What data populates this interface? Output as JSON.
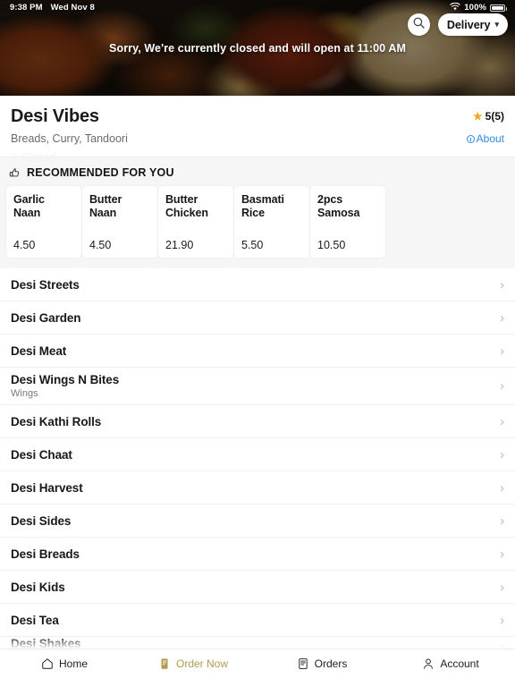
{
  "status_bar": {
    "time": "9:38 PM",
    "date": "Wed Nov 8",
    "battery_percent": "100%",
    "wifi_icon": "wifi-icon",
    "battery_icon": "battery-icon"
  },
  "hero": {
    "search_icon": "search-icon",
    "order_mode_label": "Delivery",
    "order_mode_chevron": "chevron-down-icon",
    "closed_banner": "Sorry, We're currently closed and will open at 11:00 AM"
  },
  "restaurant": {
    "name": "Desi Vibes",
    "cuisines": "Breads, Curry, Tandoori",
    "rating_value": "5(5)",
    "star_icon": "star-icon",
    "about_label": "About",
    "about_icon": "info-circle-icon",
    "status_label": "Closed",
    "status_icon": "clock-icon",
    "about_color": "#2b8ce6",
    "star_color": "#f5a623"
  },
  "recommended": {
    "heading": "RECOMMENDED FOR YOU",
    "icon": "thumbs-up-icon",
    "items": [
      {
        "name": "Garlic Naan",
        "price": "4.50"
      },
      {
        "name": "Butter Naan",
        "price": "4.50"
      },
      {
        "name": "Butter Chicken",
        "price": "21.90"
      },
      {
        "name": "Basmati Rice",
        "price": "5.50"
      },
      {
        "name": "2pcs Samosa",
        "price": "10.50"
      }
    ]
  },
  "menu_sections": [
    {
      "title": "Desi Streets",
      "subtitle": ""
    },
    {
      "title": "Desi Garden",
      "subtitle": ""
    },
    {
      "title": "Desi Meat",
      "subtitle": ""
    },
    {
      "title": "Desi Wings N Bites",
      "subtitle": "Wings"
    },
    {
      "title": "Desi Kathi Rolls",
      "subtitle": ""
    },
    {
      "title": "Desi Chaat",
      "subtitle": ""
    },
    {
      "title": "Desi Harvest",
      "subtitle": ""
    },
    {
      "title": "Desi Sides",
      "subtitle": ""
    },
    {
      "title": "Desi Breads",
      "subtitle": ""
    },
    {
      "title": "Desi Kids",
      "subtitle": ""
    },
    {
      "title": "Desi Tea",
      "subtitle": ""
    },
    {
      "title": "Desi Shakes",
      "subtitle": ""
    }
  ],
  "tabbar": {
    "active_color": "#b09a50",
    "items": [
      {
        "label": "Home",
        "icon": "home-icon",
        "active": false
      },
      {
        "label": "Order Now",
        "icon": "receipt-icon",
        "active": true
      },
      {
        "label": "Orders",
        "icon": "list-document-icon",
        "active": false
      },
      {
        "label": "Account",
        "icon": "person-icon",
        "active": false
      }
    ]
  }
}
